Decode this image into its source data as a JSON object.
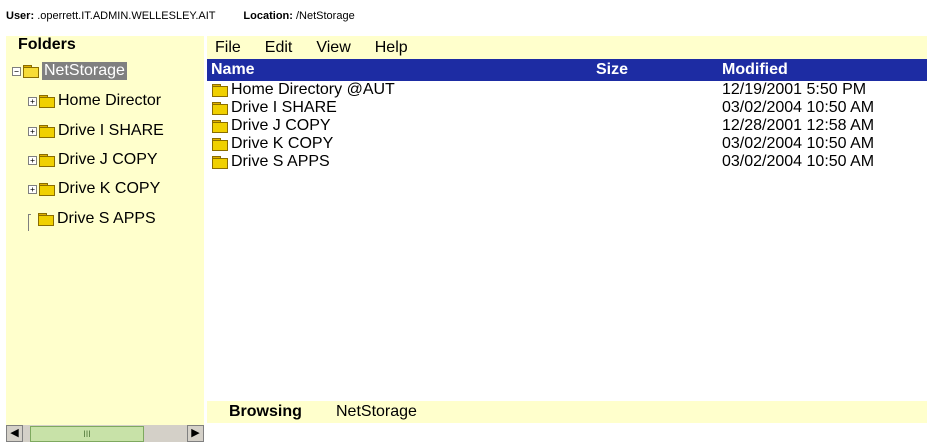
{
  "header": {
    "user_label": "User:",
    "user_value": ".operrett.IT.ADMIN.WELLESLEY.AIT",
    "location_label": "Location:",
    "location_value": "/NetStorage"
  },
  "folders": {
    "title": "Folders",
    "root": "NetStorage",
    "items": [
      {
        "label": "Home Director",
        "expander": "+"
      },
      {
        "label": "Drive I SHARE",
        "expander": "+"
      },
      {
        "label": "Drive J COPY",
        "expander": "+"
      },
      {
        "label": "Drive K COPY",
        "expander": "+"
      },
      {
        "label": "Drive S APPS",
        "expander": ""
      }
    ]
  },
  "menu": {
    "file": "File",
    "edit": "Edit",
    "view": "View",
    "help": "Help"
  },
  "table": {
    "headers": {
      "name": "Name",
      "size": "Size",
      "modified": "Modified"
    },
    "rows": [
      {
        "name": "Home Directory @AUT",
        "size": "",
        "modified": "12/19/2001 5:50 PM"
      },
      {
        "name": "Drive I SHARE",
        "size": "",
        "modified": "03/02/2004 10:50 AM"
      },
      {
        "name": "Drive J COPY",
        "size": "",
        "modified": "12/28/2001 12:58 AM"
      },
      {
        "name": "Drive K COPY",
        "size": "",
        "modified": "03/02/2004 10:50 AM"
      },
      {
        "name": "Drive S APPS",
        "size": "",
        "modified": "03/02/2004 10:50 AM"
      }
    ]
  },
  "status": {
    "label": "Browsing",
    "value": "NetStorage"
  },
  "scrollbar": {
    "thumb_glyph": "III"
  },
  "colors": {
    "panel": "#ffffcc",
    "header": "#1d2ca3",
    "selection": "#808080"
  }
}
